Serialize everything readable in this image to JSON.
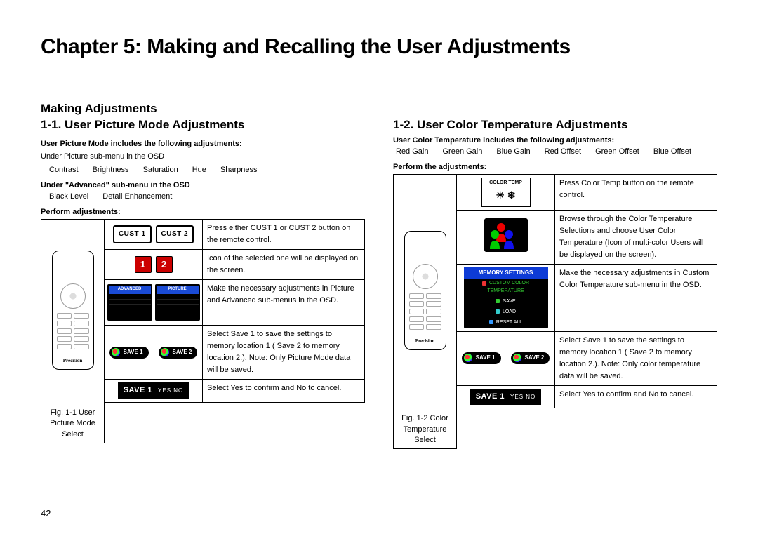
{
  "chapter_title": "Chapter 5: Making and Recalling the User Adjustments",
  "page_number": "42",
  "left": {
    "h1": "Making Adjustments",
    "h2": "1-1. User Picture Mode Adjustments",
    "intro_b": "User Picture Mode includes the following adjustments:",
    "sub1": "Under  Picture  sub-menu in the OSD",
    "pic_items": [
      "Contrast",
      "Brightness",
      "Saturation",
      "Hue",
      "Sharpness"
    ],
    "sub2_b": "Under \"Advanced\" sub-menu in the OSD",
    "adv_items": [
      "Black Level",
      "Detail Enhancement"
    ],
    "perform_b": "Perform adjustments:",
    "remote_brand": "Precision",
    "fig_caption": "Fig. 1-1 User Picture Mode Select",
    "cust1": "CUST 1",
    "cust2": "CUST 2",
    "num1": "1",
    "num2": "2",
    "osd_adv": "ADVANCED",
    "osd_pic": "PICTURE",
    "save1_pill": "SAVE 1",
    "save2_pill": "SAVE 2",
    "save_bar": "SAVE 1",
    "save_yn": "YES    NO",
    "steps": [
      "Press either  CUST 1  or  CUST 2 button on the remote control.",
      "Icon of the selected one will be displayed on the screen.",
      "Make the necessary adjustments in Picture and Advanced sub-menus in the OSD.",
      "Select  Save 1  to save the settings to memory location 1 ( Save 2  to memory location 2.). Note: Only Picture Mode data will be saved.",
      "Select  Yes  to confirm and  No to cancel."
    ]
  },
  "right": {
    "h2": "1-2. User Color Temperature Adjustments",
    "intro_b": "User Color Temperature includes the following adjustments:",
    "ct_items": [
      "Red Gain",
      "Green Gain",
      "Blue Gain",
      "Red Offset",
      "Green Offset",
      "Blue Offset"
    ],
    "perform_b": "Perform the adjustments:",
    "remote_brand": "Precision",
    "fig_caption": "Fig. 1-2 Color Temperature Select",
    "ct_label": "COLOR TEMP",
    "mem_hdr": "MEMORY SETTINGS",
    "mem_items": [
      "CUSTOM COLOR TEMPERATURE",
      "SAVE",
      "LOAD",
      "RESET ALL"
    ],
    "save1_pill": "SAVE 1",
    "save2_pill": "SAVE 2",
    "save_bar": "SAVE 1",
    "save_yn": "YES    NO",
    "steps": [
      "Press  Color Temp  button on the remote control.",
      "Browse through the Color Temperature Selections and choose  User Color Temperature  (Icon of multi-color  Users  will be displayed on the screen).",
      "Make the necessary adjustments in  Custom Color Temperature  sub-menu in the OSD.",
      "Select  Save 1  to save the settings to memory location 1 ( Save 2  to memory location 2.). Note: Only color temperature data will be saved.",
      "Select  Yes  to confirm and  No to cancel."
    ]
  }
}
